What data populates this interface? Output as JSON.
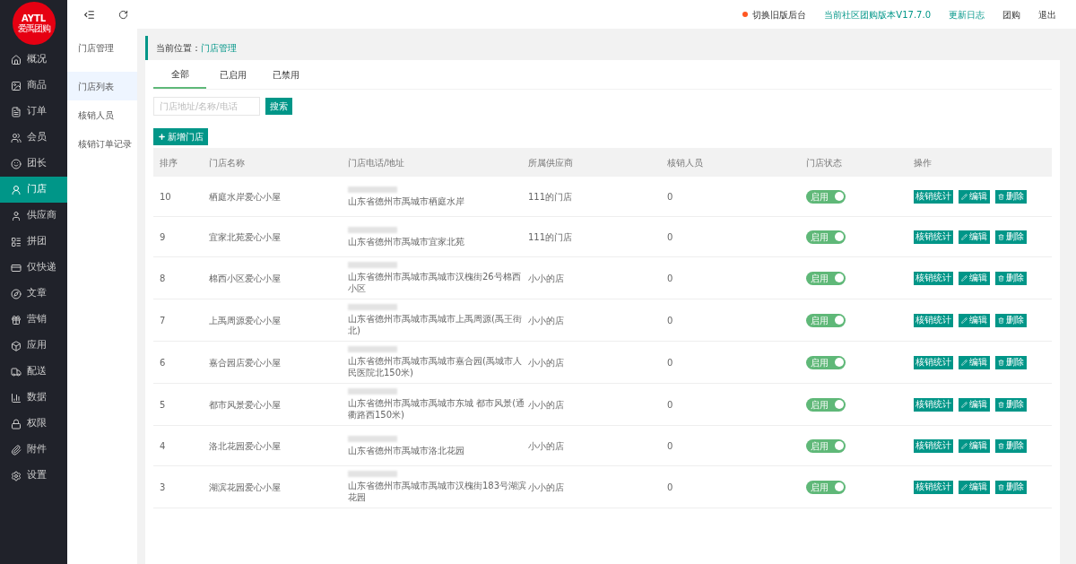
{
  "logo": {
    "line_1": "AYTL",
    "line_2": "爱禹团购"
  },
  "sidebar": {
    "items": [
      {
        "label": "概况",
        "selected": false
      },
      {
        "label": "商品",
        "selected": false
      },
      {
        "label": "订单",
        "selected": false
      },
      {
        "label": "会员",
        "selected": false
      },
      {
        "label": "团长",
        "selected": false
      },
      {
        "label": "门店",
        "selected": true
      },
      {
        "label": "供应商",
        "selected": false
      },
      {
        "label": "拼团",
        "selected": false
      },
      {
        "label": "仅快递",
        "selected": false
      },
      {
        "label": "文章",
        "selected": false
      },
      {
        "label": "营销",
        "selected": false
      },
      {
        "label": "应用",
        "selected": false
      },
      {
        "label": "配送",
        "selected": false
      },
      {
        "label": "数据",
        "selected": false
      },
      {
        "label": "权限",
        "selected": false
      },
      {
        "label": "附件",
        "selected": false
      },
      {
        "label": "设置",
        "selected": false
      }
    ]
  },
  "header_links": [
    {
      "label": "切换旧版后台",
      "kind": "dot",
      "color": "#ff5722"
    },
    {
      "label": "当前社区团购版本V17.7.0",
      "kind": "accent"
    },
    {
      "label": "更新日志",
      "kind": "accent"
    },
    {
      "label": "团购",
      "kind": "plain"
    },
    {
      "label": "退出",
      "kind": "plain"
    }
  ],
  "subnav": {
    "title": "门店管理",
    "items": [
      {
        "label": "门店列表",
        "selected": true
      },
      {
        "label": "核销人员",
        "selected": false
      },
      {
        "label": "核销订单记录",
        "selected": false
      }
    ]
  },
  "breadcrumb": {
    "label": "当前位置：",
    "current": "门店管理"
  },
  "tabs": [
    {
      "label": "全部",
      "selected": true
    },
    {
      "label": "已启用",
      "selected": false
    },
    {
      "label": "已禁用",
      "selected": false
    }
  ],
  "search": {
    "placeholder": "门店地址/名称/电话",
    "button": "搜索"
  },
  "add_button": "新增门店",
  "table": {
    "columns": [
      "排序",
      "门店名称",
      "门店电话/地址",
      "所属供应商",
      "核销人员",
      "门店状态",
      "操作"
    ],
    "rows": [
      {
        "order": "10",
        "name": "栖庭水岸爱心小屋",
        "address": "山东省德州市禹城市栖庭水岸",
        "supplier": "111的门店",
        "staff": "0",
        "status": "启用",
        "on": true,
        "actions": [
          "核销统计",
          "编辑",
          "删除"
        ]
      },
      {
        "order": "9",
        "name": "宜家北苑爱心小屋",
        "address": "山东省德州市禹城市宜家北苑",
        "supplier": "111的门店",
        "staff": "0",
        "status": "启用",
        "on": true,
        "actions": [
          "核销统计",
          "编辑",
          "删除"
        ]
      },
      {
        "order": "8",
        "name": "棉西小区爱心小屋",
        "address": "山东省德州市禹城市禹城市汉槐街26号棉西小区",
        "supplier": "小小的店",
        "staff": "0",
        "status": "启用",
        "on": true,
        "actions": [
          "核销统计",
          "编辑",
          "删除"
        ]
      },
      {
        "order": "7",
        "name": "上禹周源爱心小屋",
        "address": "山东省德州市禹城市禹城市上禹周源(禹王街北)",
        "supplier": "小小的店",
        "staff": "0",
        "status": "启用",
        "on": true,
        "actions": [
          "核销统计",
          "编辑",
          "删除"
        ]
      },
      {
        "order": "6",
        "name": "嘉合园店爱心小屋",
        "address": "山东省德州市禹城市禹城市嘉合园(禹城市人民医院北150米)",
        "supplier": "小小的店",
        "staff": "0",
        "status": "启用",
        "on": true,
        "actions": [
          "核销统计",
          "编辑",
          "删除"
        ]
      },
      {
        "order": "5",
        "name": "都市风景爱心小屋",
        "address": "山东省德州市禹城市禹城市东城 都市风景(通衢路西150米)",
        "supplier": "小小的店",
        "staff": "0",
        "status": "启用",
        "on": true,
        "actions": [
          "核销统计",
          "编辑",
          "删除"
        ]
      },
      {
        "order": "4",
        "name": "洛北花园爱心小屋",
        "address": "山东省德州市禹城市洛北花园",
        "supplier": "小小的店",
        "staff": "0",
        "status": "启用",
        "on": true,
        "actions": [
          "核销统计",
          "编辑",
          "删除"
        ]
      },
      {
        "order": "3",
        "name": "湖滨花园爱心小屋",
        "address": "山东省德州市禹城市禹城市汉槐街183号湖滨花园",
        "supplier": "小小的店",
        "staff": "0",
        "status": "启用",
        "on": true,
        "actions": [
          "核销统计",
          "编辑",
          "删除"
        ]
      }
    ]
  }
}
